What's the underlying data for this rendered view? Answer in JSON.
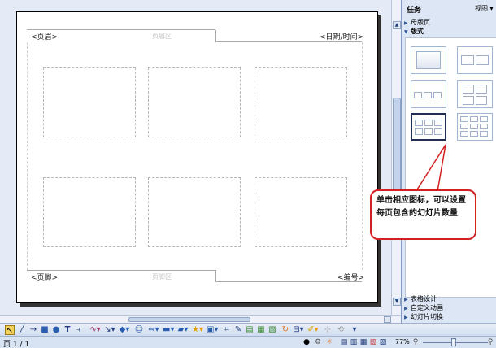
{
  "page": {
    "header_left": "<页眉>",
    "header_area": "页眉区",
    "header_right": "<日期/时间>",
    "footer_left": "<页脚>",
    "footer_area": "页脚区",
    "footer_right": "<编号>"
  },
  "taskpane": {
    "title": "任务",
    "view_menu": "视图 ▾ ×",
    "sections": {
      "master": "母版页",
      "layout": "版式",
      "table_design": "表格设计",
      "custom_animation": "自定义动画",
      "slide_transition": "幻灯片切换"
    }
  },
  "callout": {
    "text": "单击相应图标，可以设置每页包含的幻灯片数量"
  },
  "status": {
    "page": "页 1 / 1",
    "zoom": "77%"
  },
  "icons": {
    "draw": [
      "select-arrow",
      "line",
      "arrow",
      "rectangle",
      "ellipse",
      "text",
      "vertical-text",
      "curve",
      "connector",
      "basic-shapes",
      "symbol-shapes",
      "block-arrows",
      "flowchart",
      "callouts",
      "stars",
      "3d-objects",
      "points",
      "fontwork",
      "image",
      "gallery",
      "extrusion",
      "color",
      "shadow",
      "glue"
    ]
  }
}
